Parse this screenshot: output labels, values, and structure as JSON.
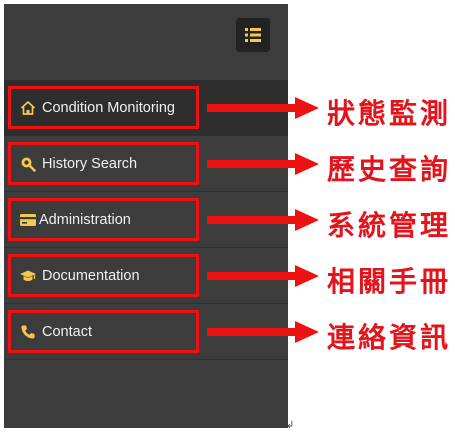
{
  "sidebar": {
    "items": [
      {
        "label": "Condition Monitoring",
        "icon": "home-icon"
      },
      {
        "label": "History Search",
        "icon": "search-icon"
      },
      {
        "label": "Administration",
        "icon": "credit-card-icon"
      },
      {
        "label": "Documentation",
        "icon": "graduation-cap-icon"
      },
      {
        "label": "Contact",
        "icon": "phone-icon"
      }
    ]
  },
  "annotations": [
    "狀態監測",
    "歷史查詢",
    "系統管理",
    "相關手冊",
    "連絡資訊"
  ],
  "colors": {
    "sidebar_bg": "#3c3c3c",
    "active_bg": "#2e2e2e",
    "icon_accent": "#f2c94c",
    "highlight_red": "#ee1111",
    "annotation_red": "#e3141b"
  }
}
